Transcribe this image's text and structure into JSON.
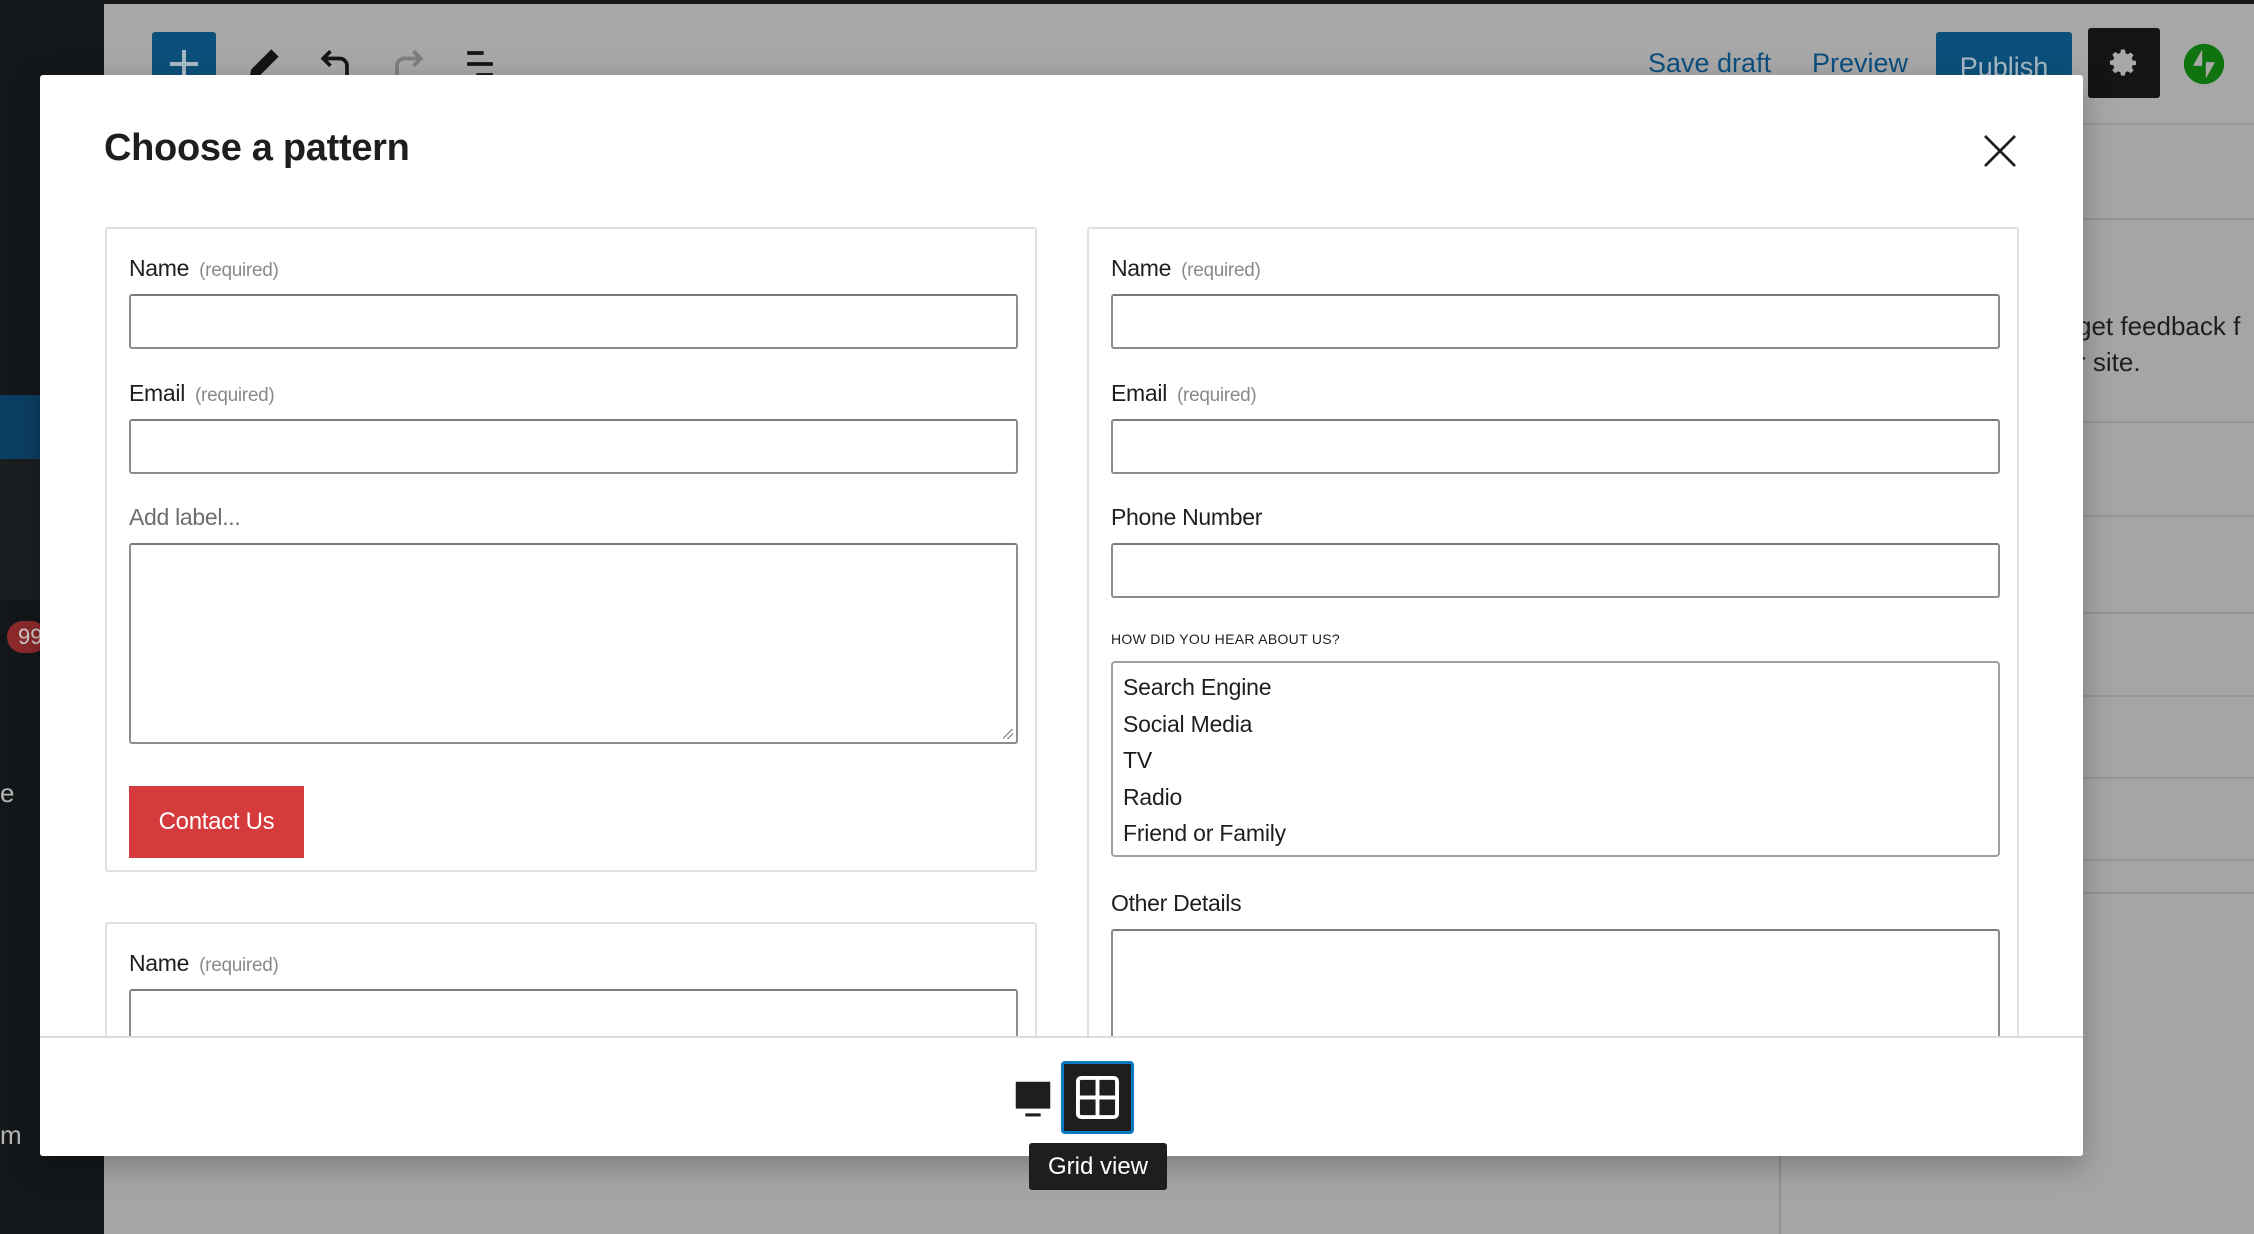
{
  "admin_sidebar": {
    "badge_count": "99",
    "text_fragment_1": "e",
    "text_fragment_2": "m"
  },
  "editor_header": {
    "inserter_icon": "plus-icon",
    "tools_icon": "pencil-icon",
    "undo_icon": "undo-icon",
    "redo_icon": "redo-icon",
    "list_view_icon": "list-view-icon",
    "save_draft_label": "Save draft",
    "preview_label": "Preview",
    "publish_label": "Publish",
    "settings_icon": "gear-icon",
    "jetpack_icon": "jetpack-bolt-icon"
  },
  "settings_panel": {
    "description_line_1": "get feedback f",
    "description_line_2": "r site."
  },
  "modal": {
    "title": "Choose a pattern",
    "close_icon": "close-icon",
    "patterns": [
      {
        "fields": [
          {
            "label": "Name",
            "required_note": "(required)",
            "type": "text",
            "value": ""
          },
          {
            "label": "Email",
            "required_note": "(required)",
            "type": "text",
            "value": ""
          },
          {
            "label": "Add label...",
            "type": "textarea",
            "value": ""
          }
        ],
        "submit_label": "Contact Us",
        "submit_color": "#d53a3c"
      },
      {
        "fields": [
          {
            "label": "Name",
            "required_note": "(required)",
            "type": "text",
            "value": ""
          },
          {
            "label": "Email",
            "required_note": "(required)",
            "type": "text",
            "value": ""
          },
          {
            "label": "Phone Number",
            "type": "text",
            "value": ""
          },
          {
            "label": "HOW DID YOU HEAR ABOUT US?",
            "type": "listbox",
            "options": [
              "Search Engine",
              "Social Media",
              "TV",
              "Radio",
              "Friend or Family"
            ]
          },
          {
            "label": "Other Details",
            "type": "textarea",
            "value": ""
          }
        ]
      },
      {
        "fields": [
          {
            "label": "Name",
            "required_note": "(required)",
            "type": "text",
            "value": ""
          }
        ]
      }
    ],
    "footer": {
      "carousel_view_icon": "carousel-view-icon",
      "grid_view_icon": "grid-view-icon",
      "active_view": "grid",
      "tooltip": "Grid view"
    }
  },
  "colors": {
    "accent": "#0a7ac0",
    "publish_bg": "#0b507a",
    "submit_red": "#d53a3c",
    "jetpack_green": "#069e08"
  }
}
